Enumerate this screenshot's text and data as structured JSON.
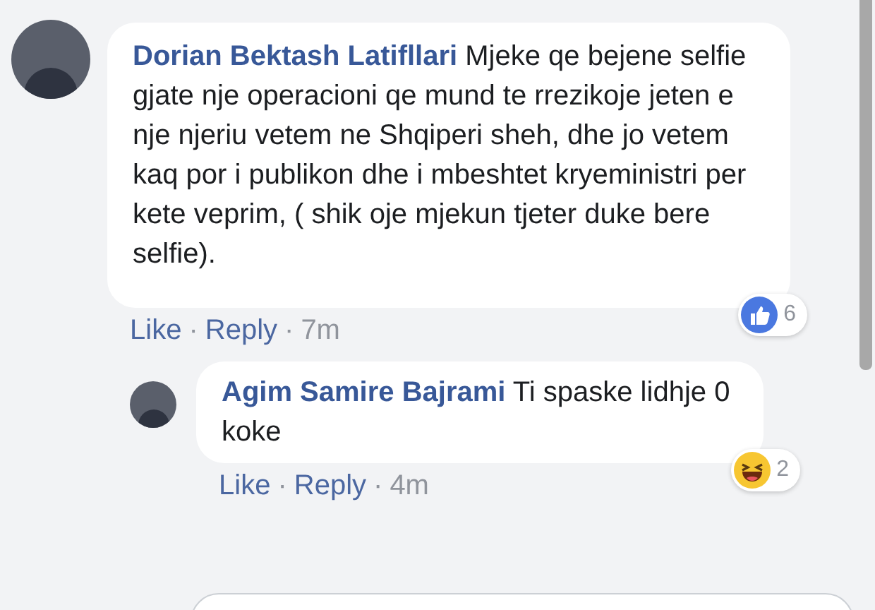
{
  "comments": [
    {
      "author": "Dorian Bektash Latifllari",
      "text": "Mjeke qe bejene selfie gjate nje operacioni qe mund te rrezikoje jeten e nje njeriu vetem ne Shqiperi sheh, dhe jo vetem kaq por i publikon dhe i mbeshtet kryeministri per kete veprim, ( shik oje mjekun tjeter duke bere selfie).",
      "reaction": {
        "kind": "like",
        "count": "6"
      },
      "actions": [
        "Like",
        "Reply"
      ],
      "separator": "·",
      "time": "7m",
      "reply": false
    },
    {
      "author": "Agim Samire Bajrami",
      "text": "Ti spaske lidhje 0 koke",
      "reaction": {
        "kind": "haha",
        "count": "2"
      },
      "actions": [
        "Like",
        "Reply"
      ],
      "separator": "·",
      "time": "4m",
      "reply": true
    }
  ]
}
